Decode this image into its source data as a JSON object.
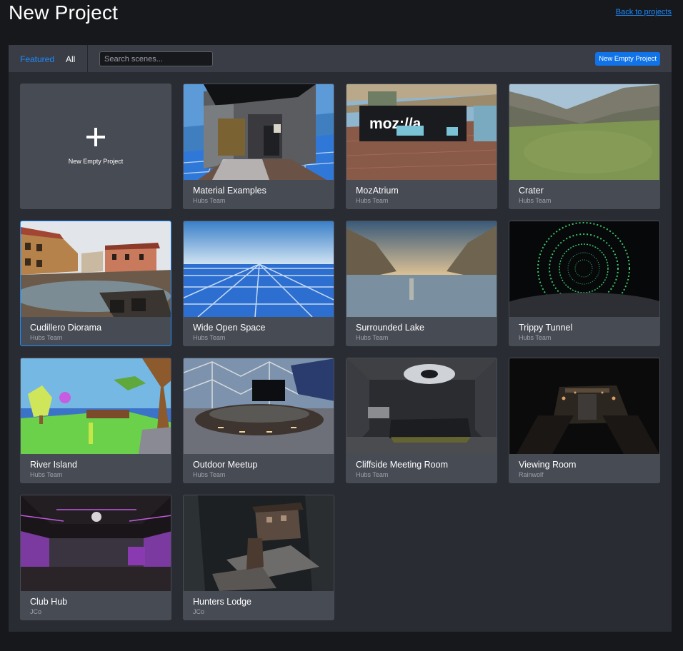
{
  "header": {
    "title": "New Project",
    "back_link": "Back to projects"
  },
  "toolbar": {
    "tabs": [
      {
        "label": "Featured",
        "active": true
      },
      {
        "label": "All",
        "active": false
      }
    ],
    "search_placeholder": "Search scenes...",
    "new_empty_label": "New Empty Project"
  },
  "empty_card": {
    "label": "New Empty Project",
    "icon": "plus-icon"
  },
  "scenes": [
    {
      "title": "Material Examples",
      "author": "Hubs Team"
    },
    {
      "title": "MozAtrium",
      "author": "Hubs Team",
      "sign": "moz://a"
    },
    {
      "title": "Crater",
      "author": "Hubs Team"
    },
    {
      "title": "Cudillero Diorama",
      "author": "Hubs Team",
      "selected": true
    },
    {
      "title": "Wide Open Space",
      "author": "Hubs Team"
    },
    {
      "title": "Surrounded Lake",
      "author": "Hubs Team"
    },
    {
      "title": "Trippy Tunnel",
      "author": "Hubs Team"
    },
    {
      "title": "River Island",
      "author": "Hubs Team"
    },
    {
      "title": "Outdoor Meetup",
      "author": "Hubs Team"
    },
    {
      "title": "Cliffside Meeting Room",
      "author": "Hubs Team"
    },
    {
      "title": "Viewing Room",
      "author": "Rainwolf"
    },
    {
      "title": "Club Hub",
      "author": "JCo"
    },
    {
      "title": "Hunters Lodge",
      "author": "JCo"
    }
  ],
  "colors": {
    "background": "#17181c",
    "panel": "#292c33",
    "toolbar": "#3a3d45",
    "card": "#474b54",
    "accent": "#1a8cff",
    "button": "#1173e8"
  }
}
